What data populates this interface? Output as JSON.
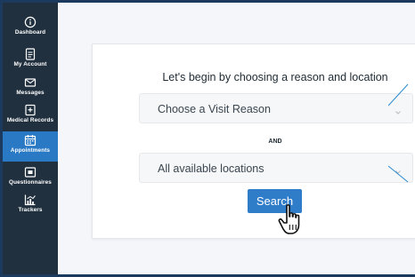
{
  "colors": {
    "sidebar_bg": "#21303f",
    "sidebar_active": "#2a79c4",
    "accent": "#2f7cc9",
    "frame_border": "#1c3a5e"
  },
  "sidebar": {
    "items": [
      {
        "label": "Dashboard",
        "icon": "info-circle-icon"
      },
      {
        "label": "My Account",
        "icon": "account-document-icon"
      },
      {
        "label": "Messages",
        "icon": "envelope-icon"
      },
      {
        "label": "Medical Records",
        "icon": "medical-record-icon"
      },
      {
        "label": "Appointments",
        "icon": "calendar-icon",
        "active": true
      },
      {
        "label": "Questionnaires",
        "icon": "questionnaire-icon"
      },
      {
        "label": "Trackers",
        "icon": "chart-tracker-icon"
      }
    ]
  },
  "main": {
    "heading": "Let's begin by choosing a reason and location",
    "visit_reason": {
      "value": "Choose a Visit Reason"
    },
    "and_label": "AND",
    "location": {
      "value": "All available locations"
    },
    "search_label": "Search"
  }
}
